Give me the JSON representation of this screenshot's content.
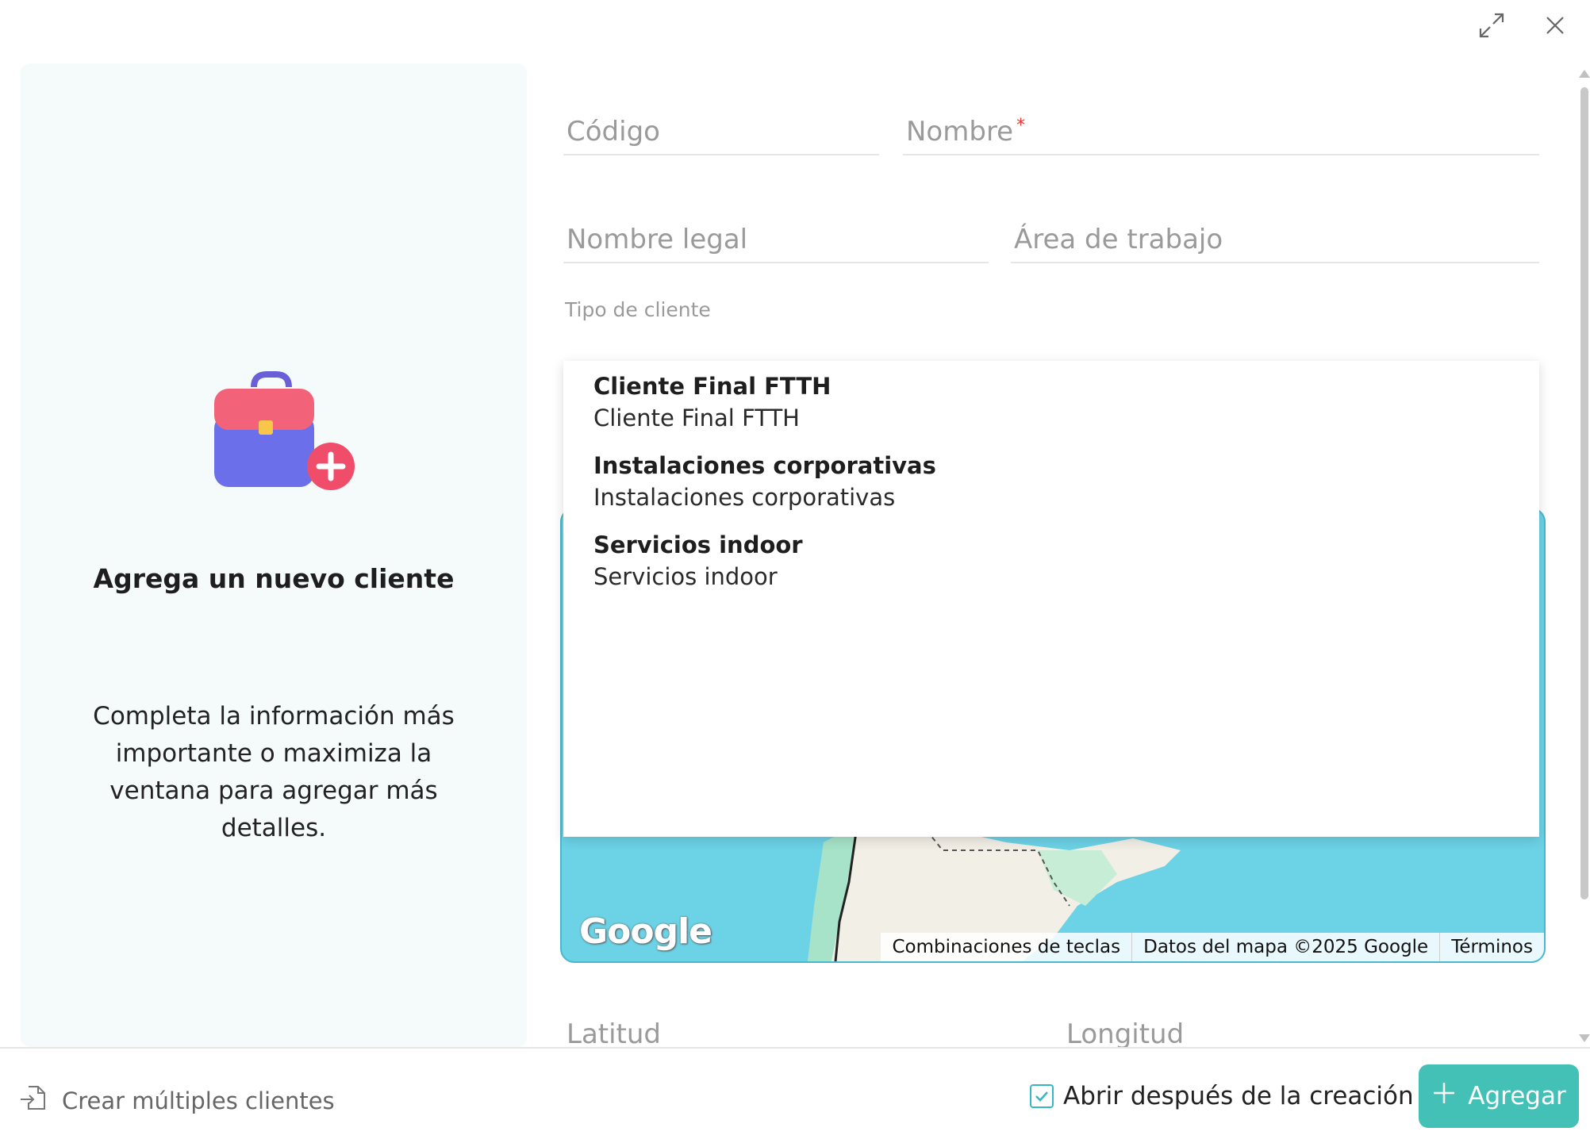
{
  "left": {
    "title": "Agrega un nuevo cliente",
    "description": "Completa la información más importante o maximiza la ventana para agregar más detalles."
  },
  "form": {
    "codigo": "Código",
    "nombre": "Nombre",
    "nombre_required": "*",
    "nombre_legal": "Nombre legal",
    "area_trabajo": "Área de trabajo",
    "tipo_cliente_label": "Tipo de cliente",
    "latitud": "Latitud",
    "longitud": "Longitud"
  },
  "dropdown": {
    "options": [
      {
        "title": "Cliente Final FTTH",
        "subtitle": "Cliente Final FTTH"
      },
      {
        "title": "Instalaciones corporativas",
        "subtitle": "Instalaciones corporativas"
      },
      {
        "title": "Servicios indoor",
        "subtitle": "Servicios indoor"
      }
    ]
  },
  "map": {
    "logo": "Google",
    "attribution": [
      "Combinaciones de teclas",
      "Datos del mapa ©2025 Google",
      "Términos"
    ]
  },
  "footer": {
    "multi_label": "Crear múltiples clientes",
    "open_after_label": "Abrir después de la creación",
    "open_after_checked": true,
    "add_label": "Agregar"
  },
  "colors": {
    "accent": "#44c1b6",
    "checkbox": "#34b8c6",
    "map_water": "#6cd2e6",
    "required": "#e53935"
  }
}
